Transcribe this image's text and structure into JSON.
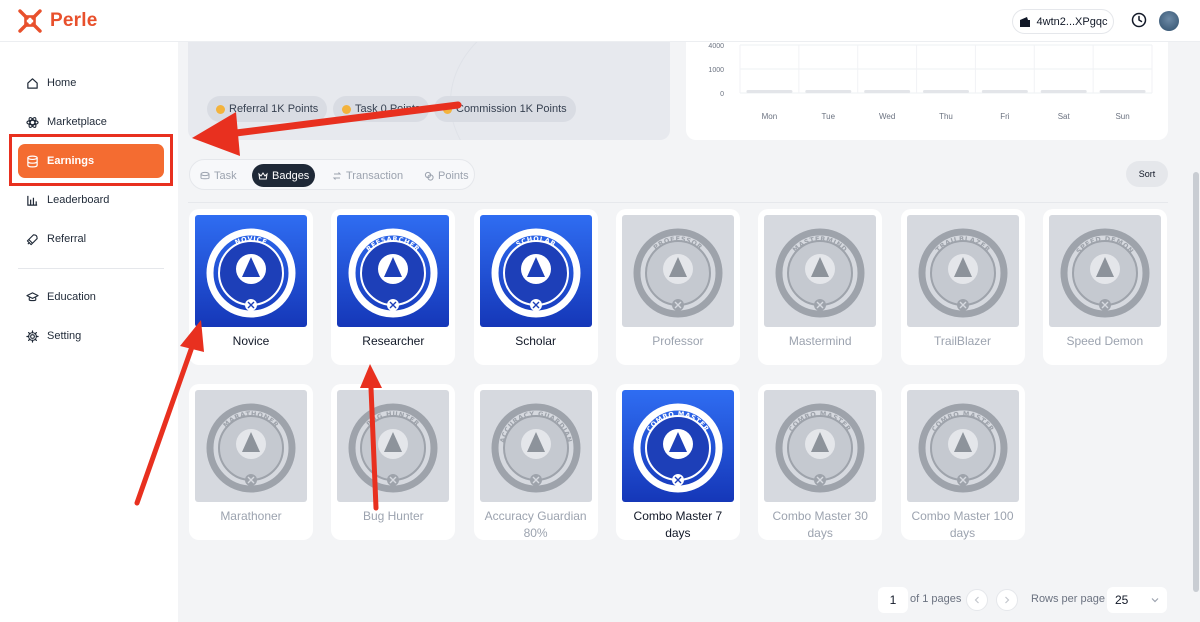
{
  "header": {
    "brand": "Perle",
    "wallet": "4wtn2...XPgqc"
  },
  "sidebar": {
    "items": [
      {
        "label": "Home",
        "icon": "home-icon"
      },
      {
        "label": "Marketplace",
        "icon": "atom-icon"
      },
      {
        "label": "Earnings",
        "icon": "database-icon",
        "active": true
      },
      {
        "label": "Leaderboard",
        "icon": "bar-chart-icon"
      },
      {
        "label": "Referral",
        "icon": "rocket-icon"
      },
      {
        "label": "Education",
        "icon": "graduation-cap-icon"
      },
      {
        "label": "Setting",
        "icon": "gear-icon"
      }
    ]
  },
  "summary": {
    "pills": [
      "Referral 1K Points",
      "Task 0 Points",
      "Commission 1K Points"
    ]
  },
  "chart_data": {
    "type": "bar",
    "categories": [
      "Mon",
      "Tue",
      "Wed",
      "Thu",
      "Fri",
      "Sat",
      "Sun"
    ],
    "values": [
      0,
      0,
      0,
      0,
      0,
      0,
      0
    ],
    "ylim": [
      0,
      4000
    ],
    "yticks": [
      "4000",
      "1000",
      "0"
    ],
    "grid": true
  },
  "tabs": [
    {
      "label": "Task",
      "icon": "coin-stack-icon"
    },
    {
      "label": "Badges",
      "icon": "crown-icon",
      "active": true
    },
    {
      "label": "Transaction",
      "icon": "swap-icon"
    },
    {
      "label": "Points",
      "icon": "coins-icon"
    }
  ],
  "sort_label": "Sort",
  "badges": [
    {
      "name": "Novice",
      "ring": "NOVICE",
      "unlocked": true
    },
    {
      "name": "Researcher",
      "ring": "REESARCHER",
      "unlocked": true
    },
    {
      "name": "Scholar",
      "ring": "SCHOLAR",
      "unlocked": true
    },
    {
      "name": "Professor",
      "ring": "PROFESSOR",
      "unlocked": false
    },
    {
      "name": "Mastermind",
      "ring": "MASTERMIND",
      "unlocked": false
    },
    {
      "name": "TrailBlazer",
      "ring": "TRAILBLAZER",
      "unlocked": false
    },
    {
      "name": "Speed Demon",
      "ring": "SPEED DEMON",
      "unlocked": false
    },
    {
      "name": "Marathoner",
      "ring": "MARATHONER",
      "unlocked": false
    },
    {
      "name": "Bug Hunter",
      "ring": "BUG HUNTER",
      "unlocked": false
    },
    {
      "name": "Accuracy Guardian 80%",
      "ring": "ACCURACY GUARDIAN",
      "unlocked": false
    },
    {
      "name": "Combo Master 7 days",
      "ring": "COMBO MASTER",
      "unlocked": true
    },
    {
      "name": "Combo Master 30 days",
      "ring": "COMBO MASTER",
      "unlocked": false
    },
    {
      "name": "Combo Master 100 days",
      "ring": "COMBO MASTER",
      "unlocked": false
    }
  ],
  "pagination": {
    "current": "1",
    "summary": "of 1 pages",
    "rows_label": "Rows per page",
    "rows_value": "25"
  },
  "colors": {
    "brand": "#e8502c",
    "active_nav": "#f46c31",
    "badge_unlocked": "#1d4fd8",
    "badge_locked": "#d6d9df",
    "annotation": "#e8301f"
  }
}
